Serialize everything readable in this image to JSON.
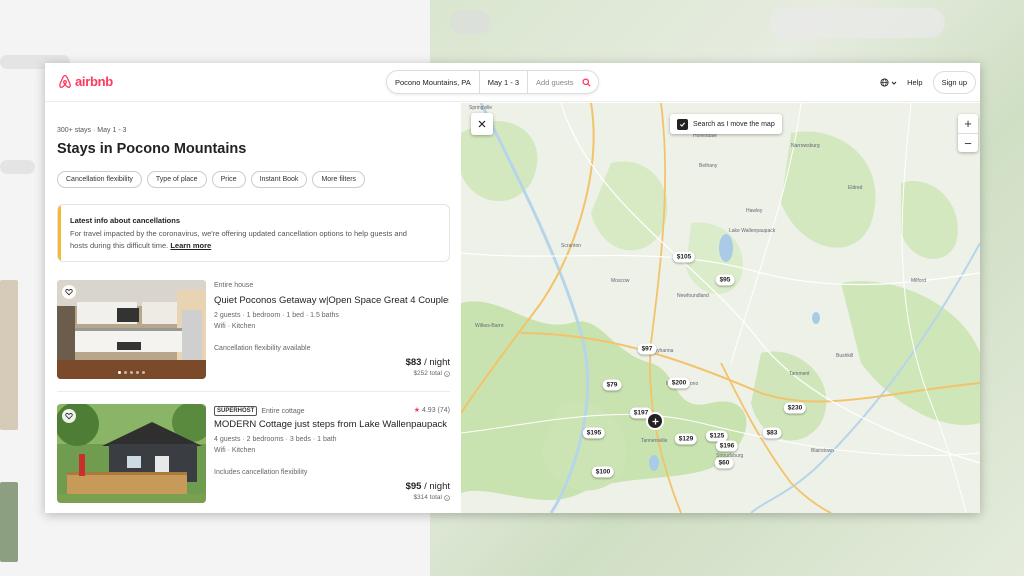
{
  "header": {
    "brand": "airbnb",
    "search": {
      "location": "Pocono Mountains, PA",
      "dates": "May 1 - 3",
      "guests": "Add guests"
    },
    "help_label": "Help",
    "signup_label": "Sign up",
    "brand_color": "#ff385c"
  },
  "results": {
    "meta": "300+ stays · May 1 - 3",
    "title": "Stays in Pocono Mountains",
    "filters": [
      "Cancellation flexibility",
      "Type of place",
      "Price",
      "Instant Book",
      "More filters"
    ]
  },
  "notice": {
    "title": "Latest info about cancellations",
    "body": "For travel impacted by the coronavirus, we're offering updated cancellation options to help guests and hosts during this difficult time.",
    "link": "Learn more"
  },
  "listings": [
    {
      "badge": "",
      "type": "Entire house",
      "title": "Quiet Poconos Getaway w|Open Space Great 4 Couples",
      "details": "2 guests · 1 bedroom · 1 bed · 1.5 baths",
      "amenities": "Wifi · Kitchen",
      "cancellation": "Cancellation flexibility available",
      "price": "$83",
      "per": "/ night",
      "total": "$252 total",
      "rating": ""
    },
    {
      "badge": "SUPERHOST",
      "type": "Entire cottage",
      "title": "MODERN Cottage just steps from Lake Wallenpaupack",
      "details": "4 guests · 2 bedrooms · 3 beds · 1 bath",
      "amenities": "Wifi · Kitchen",
      "cancellation": "Includes cancellation flexibility",
      "price": "$95",
      "per": "/ night",
      "total": "$314 total",
      "rating": "4.93 (74)"
    }
  ],
  "map": {
    "toggle_label": "Search as I move the map",
    "zoom_in": "+",
    "zoom_out": "−",
    "pins": [
      "$105",
      "$95",
      "$97",
      "$79",
      "$200",
      "$197",
      "$195",
      "$129",
      "$125",
      "$196",
      "$83",
      "$60",
      "$100",
      "$230"
    ],
    "towns": [
      "Springville",
      "Honesdale",
      "Bethany",
      "Narrowsburg",
      "Scranton",
      "Moscow",
      "Newfoundland",
      "Wilkes-Barre",
      "Tobyhanna",
      "Mount Pocono",
      "Tannersville",
      "Stroudsburg",
      "Milford",
      "Hawley",
      "Lake Wallenpaupack",
      "Bushkill",
      "Blairstown",
      "Tamment",
      "Eldred"
    ]
  }
}
